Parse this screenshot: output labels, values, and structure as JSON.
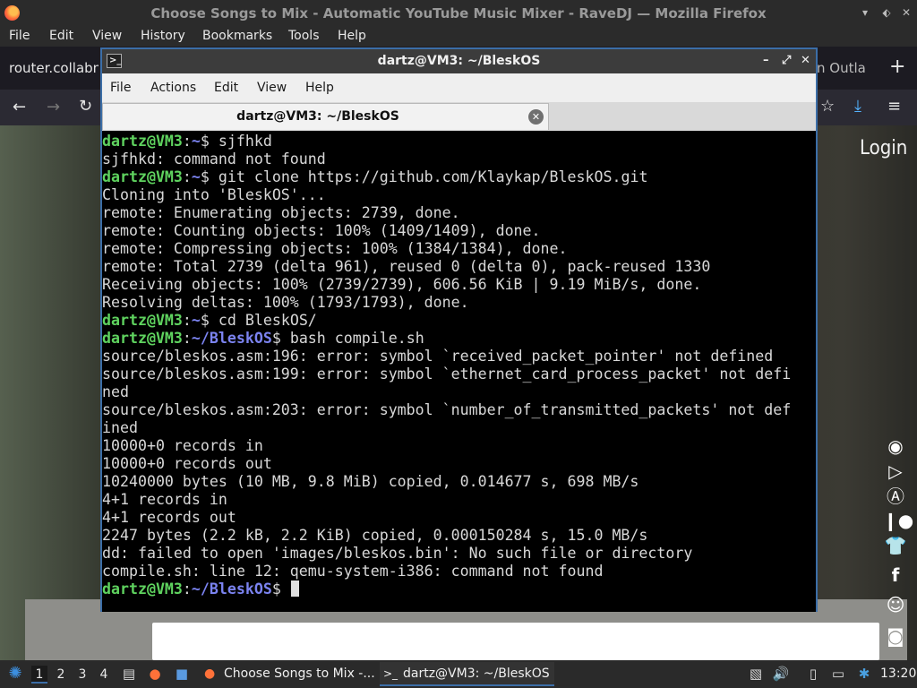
{
  "firefox": {
    "window_title": "Choose Songs to Mix - Automatic YouTube Music Mixer - RaveDJ — Mozilla Firefox",
    "menu": [
      "File",
      "Edit",
      "View",
      "History",
      "Bookmarks",
      "Tools",
      "Help"
    ],
    "tab_left_text": "router.collabne",
    "tab_right_text": "n Outla",
    "page": {
      "login_label": "Login"
    },
    "social_icons": [
      "rave-icon",
      "play-store-icon",
      "app-store-icon",
      "patreon-icon",
      "tshirt-icon",
      "facebook-icon",
      "reddit-icon",
      "discord-icon"
    ]
  },
  "terminal": {
    "title": "dartz@VM3: ~/BleskOS",
    "menu": [
      "File",
      "Actions",
      "Edit",
      "View",
      "Help"
    ],
    "tab_label": "dartz@VM3: ~/BleskOS",
    "lines": [
      {
        "user": "dartz@VM3",
        "path": "~",
        "cmd": "$ sjfhkd"
      },
      {
        "text": "sjfhkd: command not found"
      },
      {
        "user": "dartz@VM3",
        "path": "~",
        "cmd": "$ git clone https://github.com/Klaykap/BleskOS.git"
      },
      {
        "text": "Cloning into 'BleskOS'..."
      },
      {
        "text": "remote: Enumerating objects: 2739, done."
      },
      {
        "text": "remote: Counting objects: 100% (1409/1409), done."
      },
      {
        "text": "remote: Compressing objects: 100% (1384/1384), done."
      },
      {
        "text": "remote: Total 2739 (delta 961), reused 0 (delta 0), pack-reused 1330"
      },
      {
        "text": "Receiving objects: 100% (2739/2739), 606.56 KiB | 9.19 MiB/s, done."
      },
      {
        "text": "Resolving deltas: 100% (1793/1793), done."
      },
      {
        "user": "dartz@VM3",
        "path": "~",
        "cmd": "$ cd BleskOS/"
      },
      {
        "user": "dartz@VM3",
        "path": "~/BleskOS",
        "cmd": "$ bash compile.sh"
      },
      {
        "text": "source/bleskos.asm:196: error: symbol `received_packet_pointer' not defined"
      },
      {
        "text": "source/bleskos.asm:199: error: symbol `ethernet_card_process_packet' not defi"
      },
      {
        "text": "ned"
      },
      {
        "text": "source/bleskos.asm:203: error: symbol `number_of_transmitted_packets' not def"
      },
      {
        "text": "ined"
      },
      {
        "text": "10000+0 records in"
      },
      {
        "text": "10000+0 records out"
      },
      {
        "text": "10240000 bytes (10 MB, 9.8 MiB) copied, 0.014677 s, 698 MB/s"
      },
      {
        "text": "4+1 records in"
      },
      {
        "text": "4+1 records out"
      },
      {
        "text": "2247 bytes (2.2 kB, 2.2 KiB) copied, 0.000150284 s, 15.0 MB/s"
      },
      {
        "text": "dd: failed to open 'images/bleskos.bin': No such file or directory"
      },
      {
        "text": "compile.sh: line 12: qemu-system-i386: command not found"
      },
      {
        "user": "dartz@VM3",
        "path": "~/BleskOS",
        "cmd": "$ ",
        "cursor": true
      }
    ]
  },
  "taskbar": {
    "workspaces": [
      "1",
      "2",
      "3",
      "4"
    ],
    "tasks": [
      {
        "label": "Choose Songs to Mix -...",
        "icon": "firefox-icon"
      },
      {
        "label": "dartz@VM3: ~/BleskOS",
        "icon": "terminal-icon"
      }
    ],
    "clock": "13:20"
  }
}
